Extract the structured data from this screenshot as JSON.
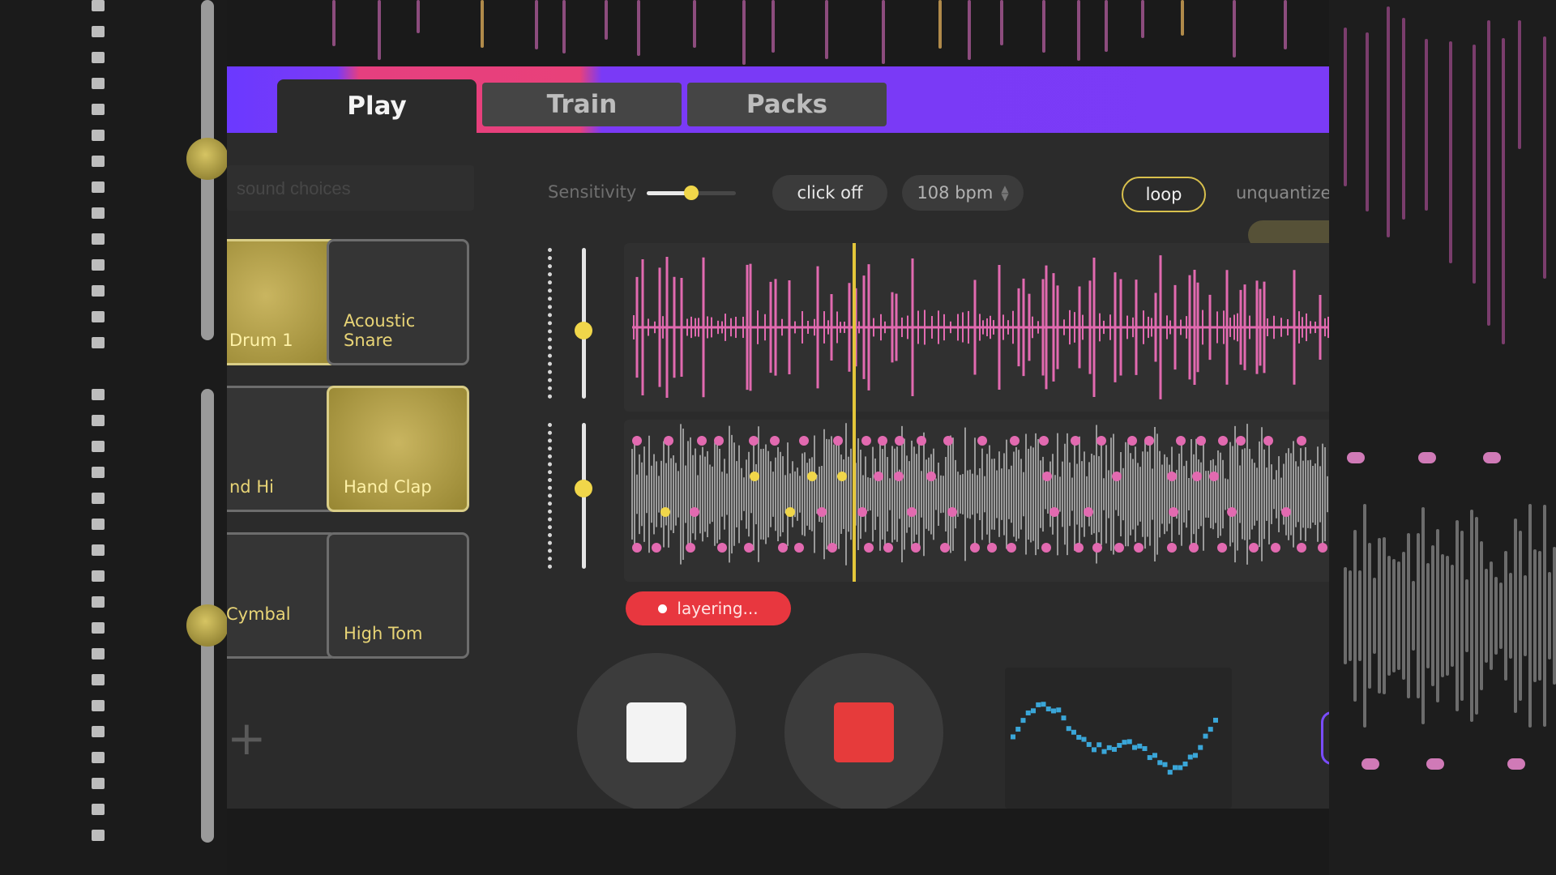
{
  "tabs": [
    {
      "id": "play",
      "label": "Play",
      "active": true
    },
    {
      "id": "train",
      "label": "Train",
      "active": false
    },
    {
      "id": "packs",
      "label": "Packs",
      "active": false
    }
  ],
  "search": {
    "placeholder": "sound choices"
  },
  "pads": [
    {
      "label": "Drum 1",
      "active": true
    },
    {
      "label": "Acoustic Snare",
      "active": false
    },
    {
      "label": "nd Hi",
      "active": false
    },
    {
      "label": "Hand Clap",
      "active": true
    },
    {
      "label": "Cymbal",
      "active": false
    },
    {
      "label": "High Tom",
      "active": false
    }
  ],
  "add_pad_symbol": "+",
  "controls": {
    "sensitivity_label": "Sensitivity",
    "sensitivity_value": 0.5,
    "click_label": "click off",
    "bpm_label": "108 bpm",
    "loop_label": "loop",
    "unquantize_label": "unquantize"
  },
  "tracks": {
    "track1_level": 0.45,
    "track2_level": 0.55,
    "playhead_position": 0.32
  },
  "status": {
    "layering_label": "layering..."
  },
  "transport": {
    "stop_icon": "stop-square-icon",
    "record_icon": "record-square-icon"
  },
  "colors": {
    "accent_purple": "#7b3bf7",
    "accent_pink": "#e8417a",
    "gold": "#f0d64a",
    "waveform_pink": "#e26ab0",
    "record_red": "#e63b3b",
    "curve_blue": "#3aa6d8"
  }
}
